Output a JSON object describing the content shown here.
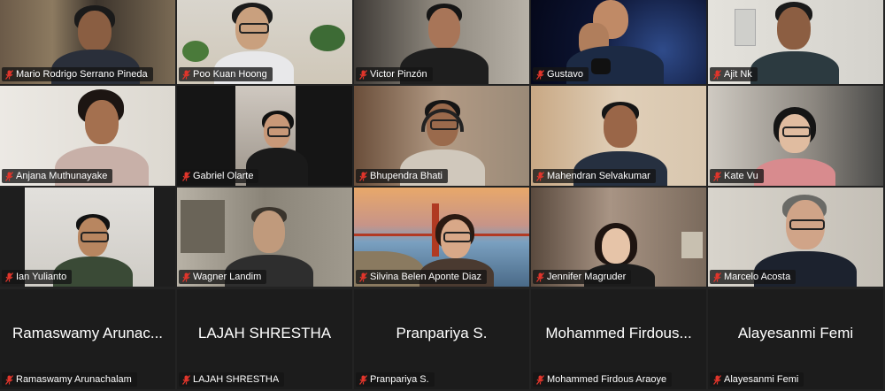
{
  "participants": [
    {
      "name": "Mario Rodrigo Serrano Pineda",
      "muted": true,
      "video": true
    },
    {
      "name": "Poo Kuan Hoong",
      "muted": true,
      "video": true
    },
    {
      "name": "Victor Pinzón",
      "muted": true,
      "video": true
    },
    {
      "name": "Gustavo",
      "muted": true,
      "video": true
    },
    {
      "name": "Ajit Nk",
      "muted": true,
      "video": true
    },
    {
      "name": "Anjana Muthunayake",
      "muted": true,
      "video": true
    },
    {
      "name": "Gabriel Olarte",
      "muted": true,
      "video": true
    },
    {
      "name": "Bhupendra Bhati",
      "muted": true,
      "video": true
    },
    {
      "name": "Mahendran Selvakumar",
      "muted": true,
      "video": true
    },
    {
      "name": "Kate Vu",
      "muted": true,
      "video": true
    },
    {
      "name": "Ian Yulianto",
      "muted": true,
      "video": true
    },
    {
      "name": "Wagner Landim",
      "muted": true,
      "video": true
    },
    {
      "name": "Silvina Belen Aponte Diaz",
      "muted": true,
      "video": true
    },
    {
      "name": "Jennifer Magruder",
      "muted": true,
      "video": true
    },
    {
      "name": "Marcelo Acosta",
      "muted": true,
      "video": true
    },
    {
      "name": "Ramaswamy Arunachalam",
      "display_name": "Ramaswamy Arunac...",
      "muted": true,
      "video": false
    },
    {
      "name": "LAJAH SHRESTHA",
      "display_name": "LAJAH SHRESTHA",
      "muted": true,
      "video": false
    },
    {
      "name": "Pranpariya S.",
      "display_name": "Pranpariya S.",
      "muted": true,
      "video": false
    },
    {
      "name": "Mohammed Firdous Araoye",
      "display_name": "Mohammed Firdous...",
      "muted": true,
      "video": false
    },
    {
      "name": "Alayesanmi Femi",
      "display_name": "Alayesanmi Femi",
      "muted": true,
      "video": false
    }
  ],
  "colors": {
    "background": "#232323",
    "muted_icon": "#e0352b",
    "name_tag_bg": "rgba(20,20,20,0.78)"
  },
  "icons": {
    "muted": "mic-off-icon"
  }
}
